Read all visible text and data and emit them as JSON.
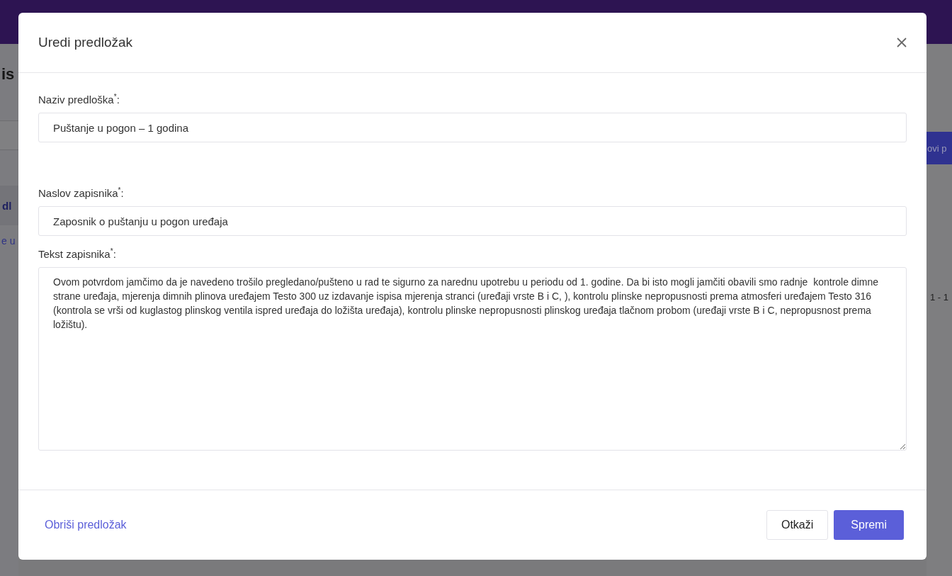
{
  "background": {
    "page_title": "is",
    "new_button": "ovi p",
    "tab": "dl",
    "row_text": "e u",
    "pagination": "1 - 1"
  },
  "modal": {
    "title": "Uredi predložak",
    "fields": [
      {
        "kind": "input",
        "label": "Naziv predloška$^{*}$:",
        "value": "Puštanje u pogon – 1 godina"
      },
      {
        "kind": "input",
        "label": "Naslov zapisnika$^{*}$:",
        "value": "Zaposnik o puštanju u pogon uređaja"
      },
      {
        "kind": "textarea",
        "label": "Tekst zapisnika$^{*}$:",
        "value": "Ovom potvrdom jamčimo da je navedeno trošilo pregledano/pušteno u rad te sigurno za narednu upotrebu u periodu od 1. godine. Da bi isto mogli jamčiti obavili smo radnje  kontrole dimne strane uređaja, mjerenja dimnih plinova uređajem Testo 300 uz izdavanje ispisa mjerenja stranci (uređaji vrste B i C, ), kontrolu plinske nepropusnosti prema atmosferi uređajem Testo 316 (kontrola se vrši od kuglastog plinskog ventila ispred uređaja do ložišta uređaja), kontrolu plinske nepropusnosti plinskog uređaja tlačnom probom (uređaji vrste B i C, nepropusnost prema ložištu)."
      }
    ],
    "delete_link": "Obriši predložak",
    "cancel_button": "Otkaži",
    "save_button": "Spremi"
  }
}
